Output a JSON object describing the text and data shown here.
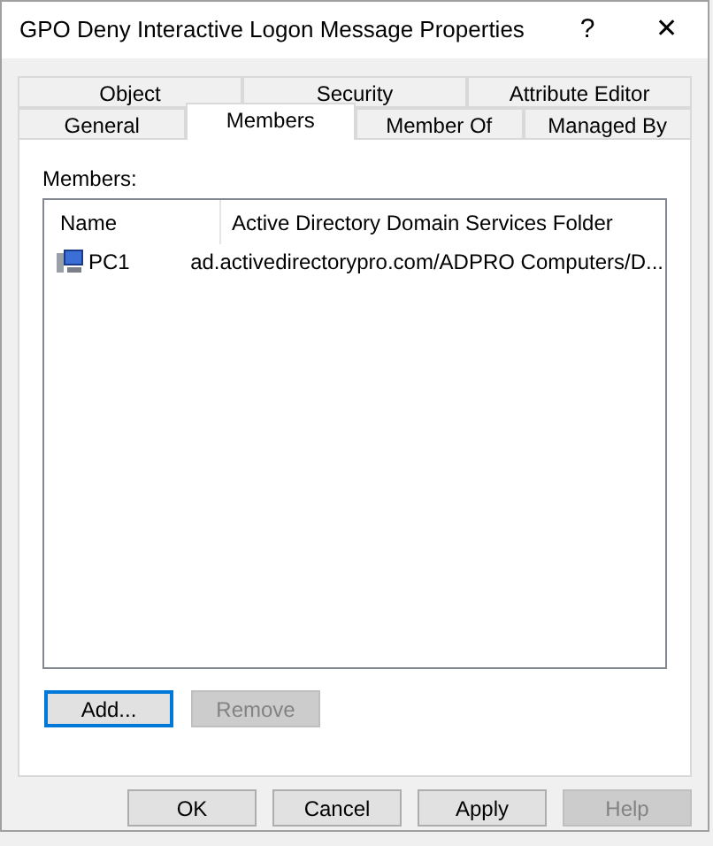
{
  "window": {
    "title": "GPO Deny Interactive Logon Message Properties",
    "help": "?",
    "close": "✕"
  },
  "tab_rows": [
    [
      {
        "label": "Object",
        "selected": false
      },
      {
        "label": "Security",
        "selected": false
      },
      {
        "label": "Attribute Editor",
        "selected": false
      }
    ],
    [
      {
        "label": "General",
        "selected": false
      },
      {
        "label": "Members",
        "selected": true
      },
      {
        "label": "Member Of",
        "selected": false
      },
      {
        "label": "Managed By",
        "selected": false
      }
    ]
  ],
  "members": {
    "label": "Members:",
    "columns": [
      "Name",
      "Active Directory Domain Services Folder"
    ],
    "rows": [
      {
        "name": "PC1",
        "folder": "ad.activedirectorypro.com/ADPRO Computers/D...",
        "selected": false
      }
    ]
  },
  "member_buttons": [
    {
      "label": "Add...",
      "disabled": false,
      "focused": true
    },
    {
      "label": "Remove",
      "disabled": true,
      "focused": false
    }
  ],
  "dialog_buttons": [
    {
      "label": "OK",
      "disabled": false
    },
    {
      "label": "Cancel",
      "disabled": false
    },
    {
      "label": "Apply",
      "disabled": false
    },
    {
      "label": "Help",
      "disabled": true
    }
  ]
}
